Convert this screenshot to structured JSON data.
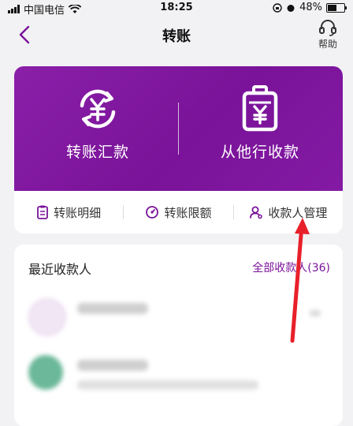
{
  "status_bar": {
    "carrier": "中国电信",
    "time": "18:25",
    "battery": "48%",
    "battery_level": 0.48
  },
  "nav": {
    "title": "转账",
    "help_label": "帮助"
  },
  "hero": {
    "actions": [
      {
        "label": "转账汇款",
        "icon": "currency-exchange-icon"
      },
      {
        "label": "从他行收款",
        "icon": "bank-bag-icon"
      }
    ]
  },
  "quick_links": [
    {
      "label": "转账明细",
      "icon": "document-icon"
    },
    {
      "label": "转账限额",
      "icon": "limit-gauge-icon"
    },
    {
      "label": "收款人管理",
      "icon": "payee-person-icon"
    }
  ],
  "recent": {
    "title": "最近收款人",
    "all_label": "全部收款人",
    "count": "(36)"
  },
  "colors": {
    "brand_purple": "#7a1399",
    "annotation_red": "#e8202a"
  }
}
